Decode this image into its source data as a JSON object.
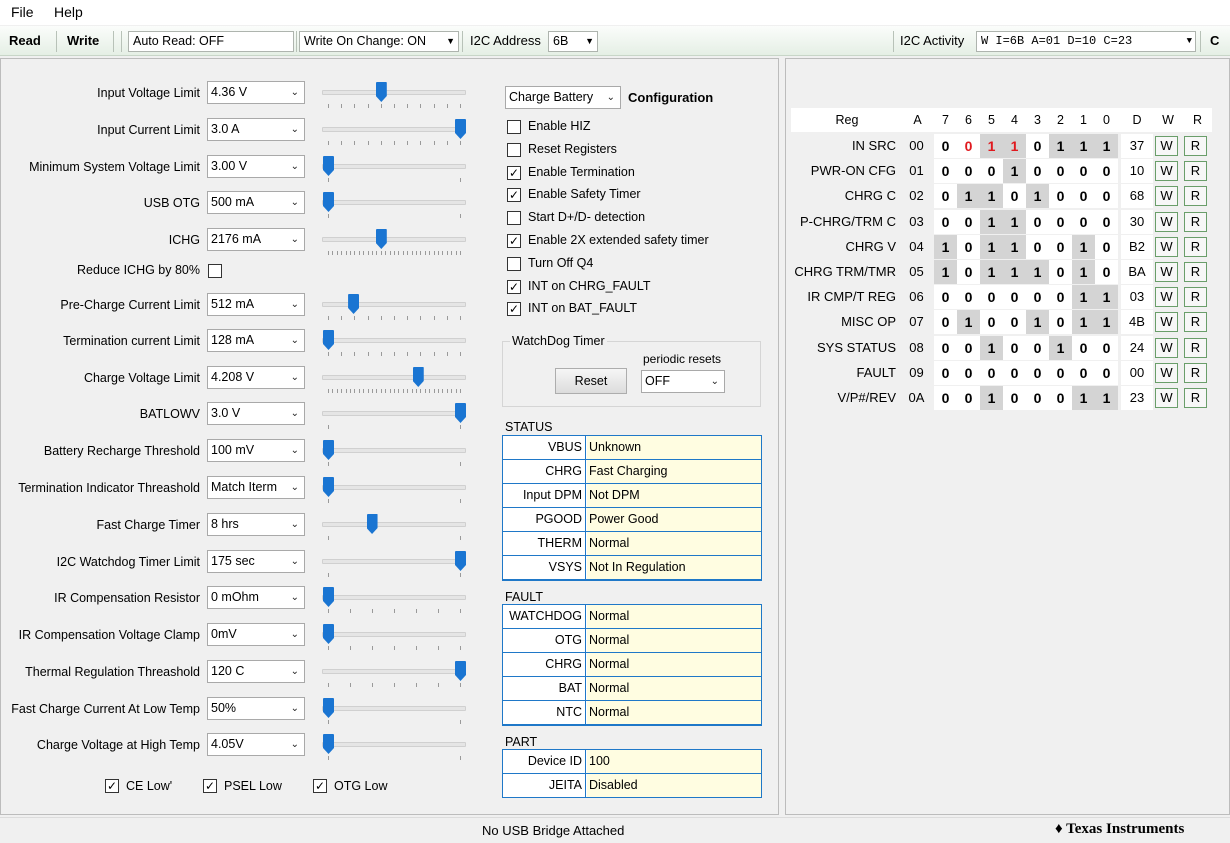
{
  "menu": {
    "file": "File",
    "help": "Help"
  },
  "toolbar": {
    "read": "Read",
    "write": "Write",
    "auto_read": "Auto Read: OFF",
    "write_on_change": "Write On Change: ON",
    "i2c_address_label": "I2C Address",
    "i2c_address": "6B",
    "i2c_activity_label": "I2C Activity",
    "i2c_activity": "W I=6B A=01 D=10 C=23",
    "c": "C"
  },
  "settings": [
    {
      "label": "Input Voltage Limit",
      "value": "4.36 V",
      "level": 0.4
    },
    {
      "label": "Input Current Limit",
      "value": "3.0 A",
      "level": 1.0
    },
    {
      "label": "Minimum System Voltage Limit",
      "value": "3.00 V",
      "level": 0.0
    },
    {
      "label": "USB OTG",
      "value": "500 mA",
      "level": 0.0
    },
    {
      "label": "ICHG",
      "value": "2176 mA",
      "level": 0.4
    },
    {
      "label": "Pre-Charge Current Limit",
      "value": "512 mA",
      "level": 0.19
    },
    {
      "label": "Termination current Limit",
      "value": "128 mA",
      "level": 0.0
    },
    {
      "label": "Charge Voltage Limit",
      "value": "4.208 V",
      "level": 0.68
    },
    {
      "label": "BATLOWV",
      "value": "3.0 V",
      "level": 1.0
    },
    {
      "label": "Battery Recharge Threshold",
      "value": "100 mV",
      "level": 0.0
    },
    {
      "label": "Termination Indicator Threashold",
      "value": "Match Iterm",
      "level": 0.0
    },
    {
      "label": "Fast Charge Timer",
      "value": "8 hrs",
      "level": 0.33
    },
    {
      "label": "I2C Watchdog Timer Limit",
      "value": "175 sec",
      "level": 1.0
    },
    {
      "label": "IR Compensation Resistor",
      "value": "0 mOhm",
      "level": 0.0
    },
    {
      "label": "IR Compensation Voltage Clamp",
      "value": "0mV",
      "level": 0.0
    },
    {
      "label": "Thermal Regulation Threashold",
      "value": "120 C",
      "level": 1.0
    },
    {
      "label": "Fast Charge Current At Low Temp",
      "value": "50%",
      "level": 0.0
    },
    {
      "label": "Charge Voltage at High Temp",
      "value": "4.05V",
      "level": 0.0
    }
  ],
  "reduce_ichg": {
    "label": "Reduce ICHG by 80%",
    "checked": false
  },
  "bottom_checks": [
    {
      "label": "CE Low'",
      "checked": true
    },
    {
      "label": "PSEL Low",
      "checked": true
    },
    {
      "label": "OTG Low",
      "checked": true
    }
  ],
  "config": {
    "mode": "Charge Battery",
    "title": "Configuration",
    "options": [
      {
        "label": "Enable HIZ",
        "checked": false
      },
      {
        "label": "Reset Registers",
        "checked": false
      },
      {
        "label": "Enable Termination",
        "checked": true
      },
      {
        "label": "Enable Safety Timer",
        "checked": true
      },
      {
        "label": "Start D+/D- detection",
        "checked": false
      },
      {
        "label": "Enable 2X extended safety timer",
        "checked": true
      },
      {
        "label": "Turn Off Q4",
        "checked": false
      },
      {
        "label": "INT on CHRG_FAULT",
        "checked": true
      },
      {
        "label": "INT on BAT_FAULT",
        "checked": true
      }
    ]
  },
  "watchdog": {
    "title": "WatchDog Timer",
    "reset": "Reset",
    "periodic_label": "periodic resets",
    "periodic_value": "OFF"
  },
  "status": {
    "title": "STATUS",
    "rows": [
      [
        "VBUS",
        "Unknown"
      ],
      [
        "CHRG",
        "Fast Charging"
      ],
      [
        "Input DPM",
        "Not DPM"
      ],
      [
        "PGOOD",
        "Power Good"
      ],
      [
        "THERM",
        "Normal"
      ],
      [
        "VSYS",
        "Not In Regulation"
      ]
    ]
  },
  "fault": {
    "title": "FAULT",
    "rows": [
      [
        "WATCHDOG",
        "Normal"
      ],
      [
        "OTG",
        "Normal"
      ],
      [
        "CHRG",
        "Normal"
      ],
      [
        "BAT",
        "Normal"
      ],
      [
        "NTC",
        "Normal"
      ]
    ]
  },
  "part": {
    "title": "PART",
    "rows": [
      [
        "Device ID",
        "100"
      ],
      [
        "JEITA",
        "Disabled"
      ]
    ]
  },
  "registers": {
    "headers": [
      "Reg",
      "A",
      "7",
      "6",
      "5",
      "4",
      "3",
      "2",
      "1",
      "0",
      "D",
      "W",
      "R"
    ],
    "rows": [
      {
        "name": "IN SRC",
        "addr": "00",
        "bits": [
          "0",
          "0",
          "1",
          "1",
          "0",
          "1",
          "1",
          "1"
        ],
        "hex": "37"
      },
      {
        "name": "PWR-ON CFG",
        "addr": "01",
        "bits": [
          "0",
          "0",
          "0",
          "1",
          "0",
          "0",
          "0",
          "0"
        ],
        "hex": "10"
      },
      {
        "name": "CHRG C",
        "addr": "02",
        "bits": [
          "0",
          "1",
          "1",
          "0",
          "1",
          "0",
          "0",
          "0"
        ],
        "hex": "68"
      },
      {
        "name": "P-CHRG/TRM C",
        "addr": "03",
        "bits": [
          "0",
          "0",
          "1",
          "1",
          "0",
          "0",
          "0",
          "0"
        ],
        "hex": "30"
      },
      {
        "name": "CHRG V",
        "addr": "04",
        "bits": [
          "1",
          "0",
          "1",
          "1",
          "0",
          "0",
          "1",
          "0"
        ],
        "hex": "B2"
      },
      {
        "name": "CHRG TRM/TMR",
        "addr": "05",
        "bits": [
          "1",
          "0",
          "1",
          "1",
          "1",
          "0",
          "1",
          "0"
        ],
        "hex": "BA"
      },
      {
        "name": "IR CMP/T REG",
        "addr": "06",
        "bits": [
          "0",
          "0",
          "0",
          "0",
          "0",
          "0",
          "1",
          "1"
        ],
        "hex": "03"
      },
      {
        "name": "MISC OP",
        "addr": "07",
        "bits": [
          "0",
          "1",
          "0",
          "0",
          "1",
          "0",
          "1",
          "1"
        ],
        "hex": "4B"
      },
      {
        "name": "SYS STATUS",
        "addr": "08",
        "bits": [
          "0",
          "0",
          "1",
          "0",
          "0",
          "1",
          "0",
          "0"
        ],
        "hex": "24"
      },
      {
        "name": "FAULT",
        "addr": "09",
        "bits": [
          "0",
          "0",
          "0",
          "0",
          "0",
          "0",
          "0",
          "0"
        ],
        "hex": "00"
      },
      {
        "name": "V/P#/REV",
        "addr": "0A",
        "bits": [
          "0",
          "0",
          "1",
          "0",
          "0",
          "0",
          "1",
          "1"
        ],
        "hex": "23"
      }
    ],
    "w": "W",
    "r": "R"
  },
  "statusbar": {
    "message": "No USB Bridge Attached",
    "brand": "Texas Instruments"
  },
  "colors": {
    "highlight_red": "#e0191e",
    "bit_shade": "#d4d4d4",
    "table_border": "#1f78c8",
    "status_value_bg": "#fffde1"
  }
}
